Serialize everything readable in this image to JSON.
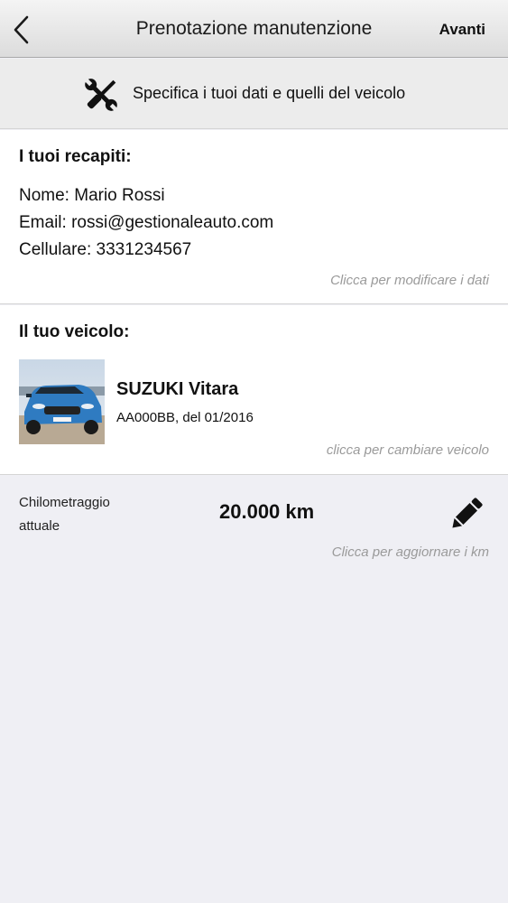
{
  "navbar": {
    "title": "Prenotazione manutenzione",
    "next_label": "Avanti",
    "back_icon": "chevron-left-icon"
  },
  "banner": {
    "icon": "tools-icon",
    "text": "Specifica i tuoi dati e quelli del veicolo"
  },
  "contacts": {
    "title": "I tuoi recapiti:",
    "name_line": "Nome: Mario Rossi",
    "email_line": "Email: rossi@gestionaleauto.com",
    "phone_line": "Cellulare: 3331234567",
    "hint": "Clicca per modificare i dati"
  },
  "vehicle": {
    "title": "Il tuo veicolo:",
    "name": "SUZUKI Vitara",
    "plate_date": "AA000BB, del 01/2016",
    "hint": "clicca per cambiare veicolo",
    "car_color": "#3b86c8"
  },
  "mileage": {
    "label": "Chilometraggio attuale",
    "value": "20.000 km",
    "hint": "Clicca per aggiornare i km",
    "edit_icon": "pencil-icon"
  }
}
